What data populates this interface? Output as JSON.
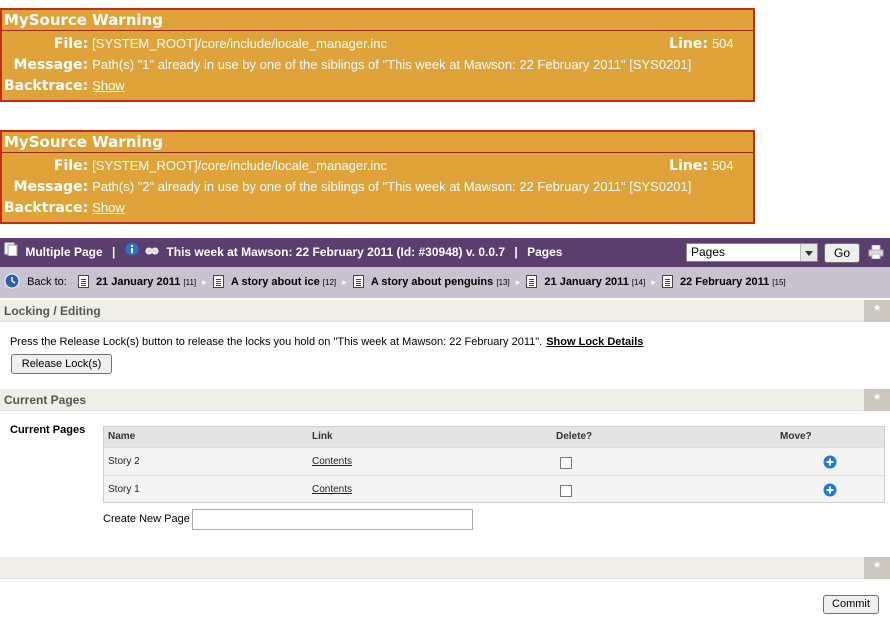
{
  "warnings": [
    {
      "title": "MySource Warning",
      "file_label": "File:",
      "file": "[SYSTEM_ROOT]/core/include/locale_manager.inc",
      "line_label": "Line:",
      "line": "504",
      "message_label": "Message:",
      "message": "Path(s) \"1\" already in use by one of the siblings of \"This week at Mawson: 22 February 2011\" [SYS0201]",
      "backtrace_label": "Backtrace:",
      "backtrace_link": "Show"
    },
    {
      "title": "MySource Warning",
      "file_label": "File:",
      "file": "[SYSTEM_ROOT]/core/include/locale_manager.inc",
      "line_label": "Line:",
      "line": "504",
      "message_label": "Message:",
      "message": "Path(s) \"2\" already in use by one of the siblings of \"This week at Mawson: 22 February 2011\" [SYS0201]",
      "backtrace_label": "Backtrace:",
      "backtrace_link": "Show"
    }
  ],
  "asset_bar": {
    "type_label": "Multiple Page",
    "sep1": "|",
    "asset_title": "This week at Mawson: 22 February 2011 (Id: #30948) v. 0.0.7",
    "sep2": "|",
    "screen": "Pages",
    "select_value": "Pages",
    "go_label": "Go",
    "icons": [
      "multiple-page-icon",
      "info-icon",
      "preview-icon",
      "print-icon"
    ]
  },
  "breadcrumb": {
    "back_label": "Back to:",
    "items": [
      {
        "label": "21 January 2011",
        "id": "[11]"
      },
      {
        "label": "A story about ice",
        "id": "[12]"
      },
      {
        "label": "A story about penguins",
        "id": "[13]"
      },
      {
        "label": "21 January 2011",
        "id": "[14]"
      },
      {
        "label": "22 February 2011",
        "id": "[15]"
      }
    ]
  },
  "locking": {
    "section_title": "Locking / Editing",
    "message": "Press the Release Lock(s) button to release the locks you hold on \"This week at Mawson: 22 February 2011\".",
    "details_link": "Show Lock Details",
    "release_button": "Release Lock(s)"
  },
  "current_pages": {
    "section_title": "Current Pages",
    "field_label": "Current Pages",
    "columns": [
      "Name",
      "Link",
      "Delete?",
      "Move?"
    ],
    "rows": [
      {
        "name": "Story 2",
        "link": "Contents",
        "delete": false
      },
      {
        "name": "Story 1",
        "link": "Contents",
        "delete": false
      }
    ],
    "create_label": "Create New Page",
    "create_value": ""
  },
  "star": "*",
  "commit_label": "Commit",
  "colors": {
    "warning_bg": "#e0a33a",
    "warning_border": "#c42b1c",
    "asset_bar_bg": "#5a3f6e",
    "breadcrumb_bg": "#c9c2d1",
    "section_bg": "#efefe8"
  }
}
